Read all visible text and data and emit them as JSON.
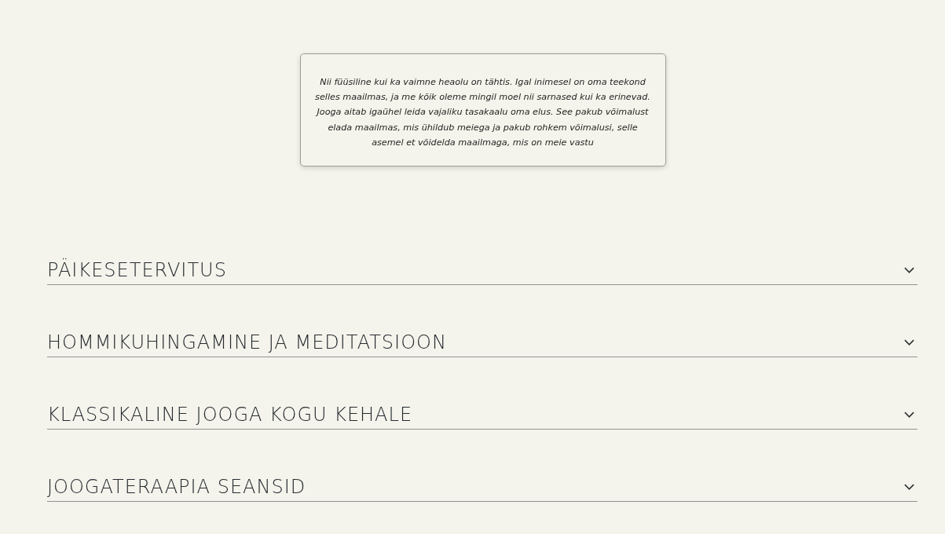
{
  "intro": {
    "text": "Nii füüsiline kui ka vaimne heaolu on tähtis. Igal inimesel on oma teekond selles maailmas, ja me kõik oleme mingil moel nii sarnased kui ka erinevad. Jooga aitab igaühel leida vajaliku tasakaalu oma elus. See pakub võimalust elada maailmas, mis ühildub meiega ja pakub rohkem võimalusi, selle asemel et võidelda maailmaga, mis on meie vastu"
  },
  "sections": [
    {
      "title": "PÄIKESETERVITUS",
      "expanded": false
    },
    {
      "title": "HOMMIKUHINGAMINE JA MEDITATSIOON",
      "expanded": false
    },
    {
      "title": "KLASSIKALINE JOOGA KOGU KEHALE",
      "expanded": false
    },
    {
      "title": "JOOGATERAAPIA SEANSID",
      "expanded": false
    }
  ]
}
